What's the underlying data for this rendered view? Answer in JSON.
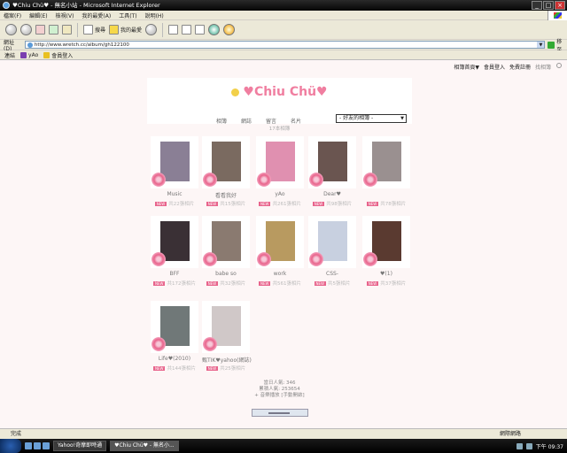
{
  "window": {
    "title": "♥Chiu Chü♥ - 無名小站 - Microsoft Internet Explorer"
  },
  "menu": [
    "檔案(F)",
    "編輯(E)",
    "檢視(V)",
    "我的最愛(A)",
    "工具(T)",
    "說明(H)"
  ],
  "toolbar": {
    "search_label": "搜尋",
    "favorites_label": "我的最愛"
  },
  "address": {
    "label": "網址(D)",
    "url": "http://www.wretch.cc/album/gh122100",
    "go_label": "移至"
  },
  "links": {
    "label": "連結",
    "items": [
      "yAo",
      "會員登入"
    ]
  },
  "topnav": [
    "相簿首頁▼",
    "會員登入",
    "免費註冊",
    "找相簿"
  ],
  "header": {
    "title": "♥Chiu Chü♥",
    "nav": [
      "相簿",
      "網誌",
      "留言",
      "名片"
    ],
    "friends_select": "- 好友的相簿 -"
  },
  "album_count": "17本相簿",
  "albums": [
    {
      "name": "Music",
      "meta": "共22張相片",
      "color": "#8a7f95"
    },
    {
      "name": "看看我好",
      "meta": "共15張相片",
      "color": "#7a6a60"
    },
    {
      "name": "yAo",
      "meta": "共261張相片",
      "color": "#e090b0"
    },
    {
      "name": "Dear♥",
      "meta": "共98張相片",
      "color": "#6a5550"
    },
    {
      "name": "",
      "meta": "共78張相片",
      "color": "#9a9090"
    },
    {
      "name": "BFF",
      "meta": "共172張相片",
      "color": "#3a3035"
    },
    {
      "name": "babe so",
      "meta": "共32張相片",
      "color": "#8a7a70"
    },
    {
      "name": "work",
      "meta": "共561張相片",
      "color": "#b89a60"
    },
    {
      "name": "CSS-",
      "meta": "共5張相片",
      "color": "#c8d0e0"
    },
    {
      "name": "♥(1)",
      "meta": "共37張相片",
      "color": "#5a3a30"
    },
    {
      "name": "Life♥(2010)",
      "meta": "共144張相片",
      "color": "#707878"
    },
    {
      "name": "甄TIK♥yahoo(網誌)",
      "meta": "共25張相片",
      "color": "#d0c8c8"
    }
  ],
  "stats": {
    "today": "當日人氣: 346",
    "total": "累積人氣: 253654",
    "music": "+ 音樂播放 [手動開啟]"
  },
  "status": {
    "text": "完成",
    "zone": "網際網路"
  },
  "taskbar": {
    "tasks": [
      "Yahoo!奇摩即時通",
      "♥Chiu Chü♥ - 無名小..."
    ],
    "clock": "下午 09:37"
  }
}
